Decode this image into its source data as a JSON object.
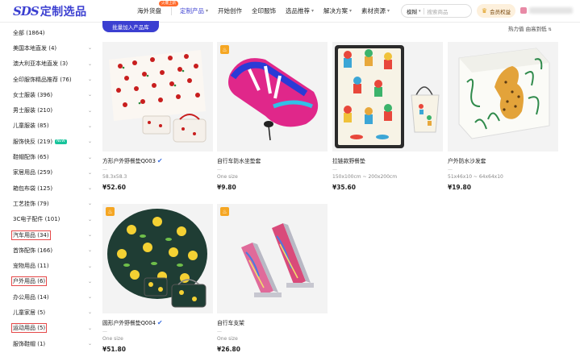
{
  "header": {
    "logo_mark": "SDS",
    "logo_text": "定制选品",
    "nav": [
      {
        "label": "海外货盘",
        "badge": "火爆上新",
        "chevron": false,
        "active": false
      },
      {
        "label": "定制产品",
        "chevron": true,
        "active": true
      },
      {
        "label": "开始创作",
        "chevron": false,
        "active": false
      },
      {
        "label": "全印服饰",
        "chevron": false,
        "active": false
      },
      {
        "label": "选品推荐",
        "chevron": true,
        "active": false
      },
      {
        "label": "解决方案",
        "chevron": true,
        "active": false
      },
      {
        "label": "素材资源",
        "chevron": true,
        "active": false
      }
    ],
    "search": {
      "scope": "模糊",
      "placeholder": "搜索商品"
    },
    "vip_label": "会员权益",
    "accent_color": "#3b3fd1"
  },
  "sidebar": {
    "categories": [
      {
        "label": "全部 (1864)",
        "chevron": false,
        "highlighted": false,
        "new": false
      },
      {
        "label": "美国本地直发 (4)",
        "chevron": true,
        "highlighted": false,
        "new": false
      },
      {
        "label": "澳大利亚本地直发 (3)",
        "chevron": true,
        "highlighted": false,
        "new": false
      },
      {
        "label": "全印服饰精品推荐 (76)",
        "chevron": true,
        "highlighted": false,
        "new": false
      },
      {
        "label": "女士服装 (396)",
        "chevron": true,
        "highlighted": false,
        "new": false
      },
      {
        "label": "男士服装 (210)",
        "chevron": true,
        "highlighted": false,
        "new": false
      },
      {
        "label": "儿童服装 (85)",
        "chevron": true,
        "highlighted": false,
        "new": false
      },
      {
        "label": "服饰快反 (219)",
        "chevron": true,
        "highlighted": false,
        "new": true,
        "new_label": "NEW"
      },
      {
        "label": "鞋帽配饰 (65)",
        "chevron": true,
        "highlighted": false,
        "new": false
      },
      {
        "label": "家居用品 (259)",
        "chevron": true,
        "highlighted": false,
        "new": false
      },
      {
        "label": "箱包布袋 (125)",
        "chevron": true,
        "highlighted": false,
        "new": false
      },
      {
        "label": "工艺挂饰 (79)",
        "chevron": true,
        "highlighted": false,
        "new": false
      },
      {
        "label": "3C电子配件 (101)",
        "chevron": true,
        "highlighted": false,
        "new": false
      },
      {
        "label": "汽车用品 (34)",
        "chevron": true,
        "highlighted": true,
        "new": false
      },
      {
        "label": "首饰配饰 (166)",
        "chevron": true,
        "highlighted": false,
        "new": false
      },
      {
        "label": "宠物用品 (11)",
        "chevron": true,
        "highlighted": false,
        "new": false
      },
      {
        "label": "户外用品 (6)",
        "chevron": true,
        "highlighted": true,
        "new": false
      },
      {
        "label": "办公用品 (14)",
        "chevron": true,
        "highlighted": false,
        "new": false
      },
      {
        "label": "儿童家居 (5)",
        "chevron": true,
        "highlighted": false,
        "new": false
      },
      {
        "label": "运动用品 (5)",
        "chevron": true,
        "highlighted": true,
        "new": false
      },
      {
        "label": "服饰鞋帽 (1)",
        "chevron": true,
        "highlighted": false,
        "new": false
      }
    ]
  },
  "toolbar": {
    "batch_button": "批量加入产品库",
    "sort_label": "热力值",
    "sort_order": "由高到低"
  },
  "products": [
    {
      "title": "方形户外野餐垫Q003",
      "verified": true,
      "badge": false,
      "spec": "58.3x58.3",
      "price": "¥52.60",
      "dash": "—"
    },
    {
      "title": "自行车防水坐垫套",
      "verified": false,
      "badge": true,
      "spec": "One size",
      "price": "¥9.80",
      "dash": "—"
    },
    {
      "title": "拉链款野餐垫",
      "verified": false,
      "badge": false,
      "spec": "150x100cm ~ 200x200cm",
      "price": "¥35.60",
      "dash": "—"
    },
    {
      "title": "户外防水沙发套",
      "verified": false,
      "badge": false,
      "spec": "51x46x10 ~ 64x64x10",
      "price": "¥19.80",
      "dash": "—"
    },
    {
      "title": "圆形户外野餐垫Q004",
      "verified": true,
      "badge": true,
      "spec": "One size",
      "price": "¥51.80",
      "dash": "—"
    },
    {
      "title": "自行车支架",
      "verified": false,
      "badge": true,
      "spec": "One size",
      "price": "¥26.80",
      "dash": "—"
    }
  ]
}
